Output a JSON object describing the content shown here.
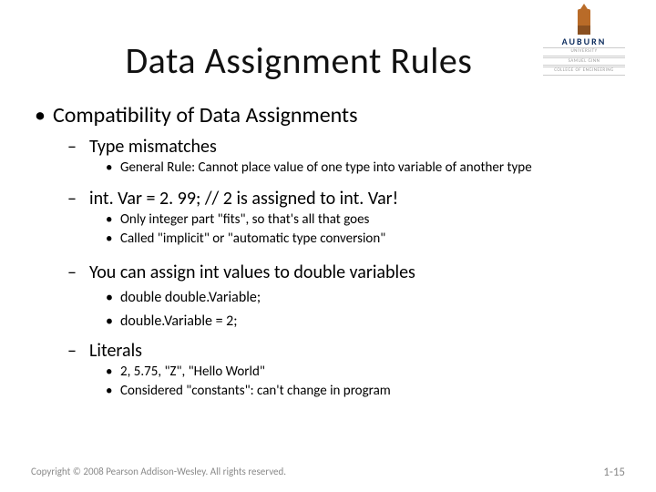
{
  "logo": {
    "university": "AUBURN",
    "sub1": "UNIVERSITY",
    "sub2": "SAMUEL GINN",
    "sub3": "COLLEGE OF ENGINEERING"
  },
  "title": "Data Assignment Rules",
  "bullets": {
    "l1_1": "Compatibility of Data Assignments",
    "l2_1": "Type mismatches",
    "l3_1": "General Rule: Cannot place value of one type into variable of another type",
    "l2_2": "int. Var = 2. 99;    // 2 is assigned to int. Var!",
    "l3_2": "Only integer part \"fits\", so that's all that goes",
    "l3_3": "Called \"implicit\" or \"automatic type conversion\"",
    "l2_3": "You can assign int values to double variables",
    "l3_4": "double double.Variable;",
    "l3_5": "double.Variable = 2;",
    "l2_4": "Literals",
    "l3_6": "2, 5.75, \"Z\", \"Hello World\"",
    "l3_7": "Considered \"constants\": can't change in program"
  },
  "footer": {
    "copyright": "Copyright © 2008 Pearson Addison-Wesley. All rights reserved.",
    "page": "1-15"
  }
}
